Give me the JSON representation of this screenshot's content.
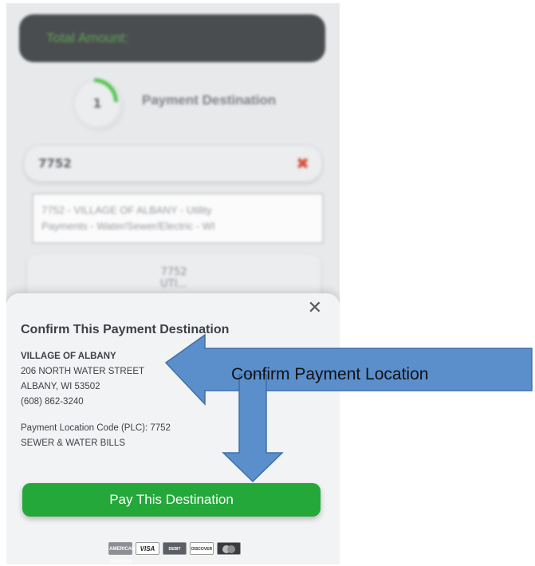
{
  "background_screen": {
    "total_label": "Total Amount:",
    "step_number": "1",
    "step_title": "Payment Destination",
    "search_value": "7752",
    "clear_icon": "close-icon",
    "suggestion_line1": "7752 - VILLAGE OF ALBANY - Utility",
    "suggestion_line2": "Payments - Water/Sewer/Electric - WI",
    "card_line1": "7752",
    "card_line2": "UTI..."
  },
  "modal": {
    "close_glyph": "✕",
    "title": "Confirm This Payment Destination",
    "address": {
      "name": "VILLAGE OF ALBANY",
      "street": "206 NORTH WATER STREET",
      "city": "ALBANY, WI 53502",
      "phone": "(608) 862-3240"
    },
    "plc": "Payment Location Code (PLC): 7752",
    "bill_type": "SEWER & WATER BILLS",
    "pay_button": "Pay This Destination",
    "card_logos": [
      "AMERICAN EXPRESS",
      "VISA",
      "DEBIT",
      "DISCOVER",
      "MASTERCARD"
    ]
  },
  "annotation": {
    "arrow_label": "Confirm Payment Location",
    "arrow_color": "#5b8fcc",
    "arrow_stroke": "#3f6fa8"
  },
  "colors": {
    "accent_green": "#24a83a",
    "dark_bar": "#2f3236",
    "clear_red": "#d4351c"
  }
}
